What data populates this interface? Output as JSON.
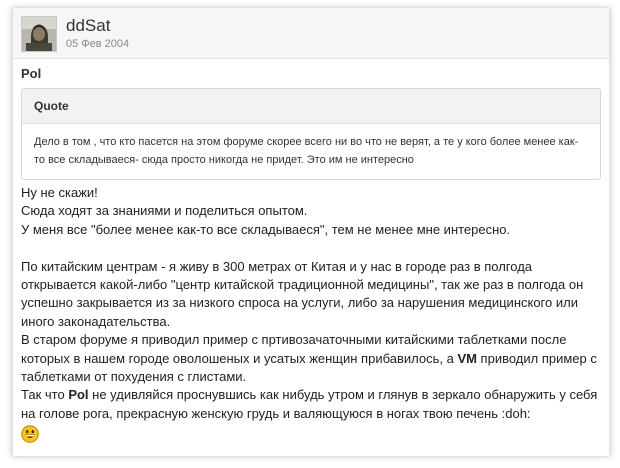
{
  "post": {
    "username": "ddSat",
    "date": "05 Фев 2004"
  },
  "quote": {
    "author": "Pol",
    "title": "Quote",
    "text": "Дело в том , что кто пасется на этом форуме скорее всего ни во что не верят, а те у кого более менее как-то все складываеся- сюда просто никогда не придет. Это им не интересно"
  },
  "message": {
    "line1": "Ну не скажи!",
    "line2": "Сюда ходят за знаниями и поделиться опытом.",
    "line3": "У меня все \"более менее как-то все складываеся\", тем не менее мне интересно.",
    "para1": "По китайским центрам - я живу в 300 метрах от Китая и у нас в городе раз в полгода открывается какой-либо \"центр китайской традиционной медицины\", так же раз в полгода он успешно закрывается из за низкого спроса на услуги, либо за нарушения медицинского или иного законадательства.",
    "para2_before": "В старом форуме я приводил пример с пртивозачаточными китайскими таблетками после которых в нашем городе оволошеных и усатых женщин прибавилось, а ",
    "para2_bold": "VM",
    "para2_after": " приводил пример с таблетками от похудения с глистами.",
    "para3_before": "Так что ",
    "para3_bold": "Pol",
    "para3_after": " не удивляйся проснувшись как нибудь утром и глянув в зеркало обнаружить у себя на голове рога, прекрасную женскую грудь и валяющуюся в ногах твою печень :doh:"
  },
  "icons": {
    "avatar": "user-avatar-image",
    "smiley": "grin-smiley-icon"
  },
  "colors": {
    "header_bg": "#f6f6f6",
    "quote_title_bg": "#f2f2f2",
    "smiley_yellow": "#f5c518"
  }
}
